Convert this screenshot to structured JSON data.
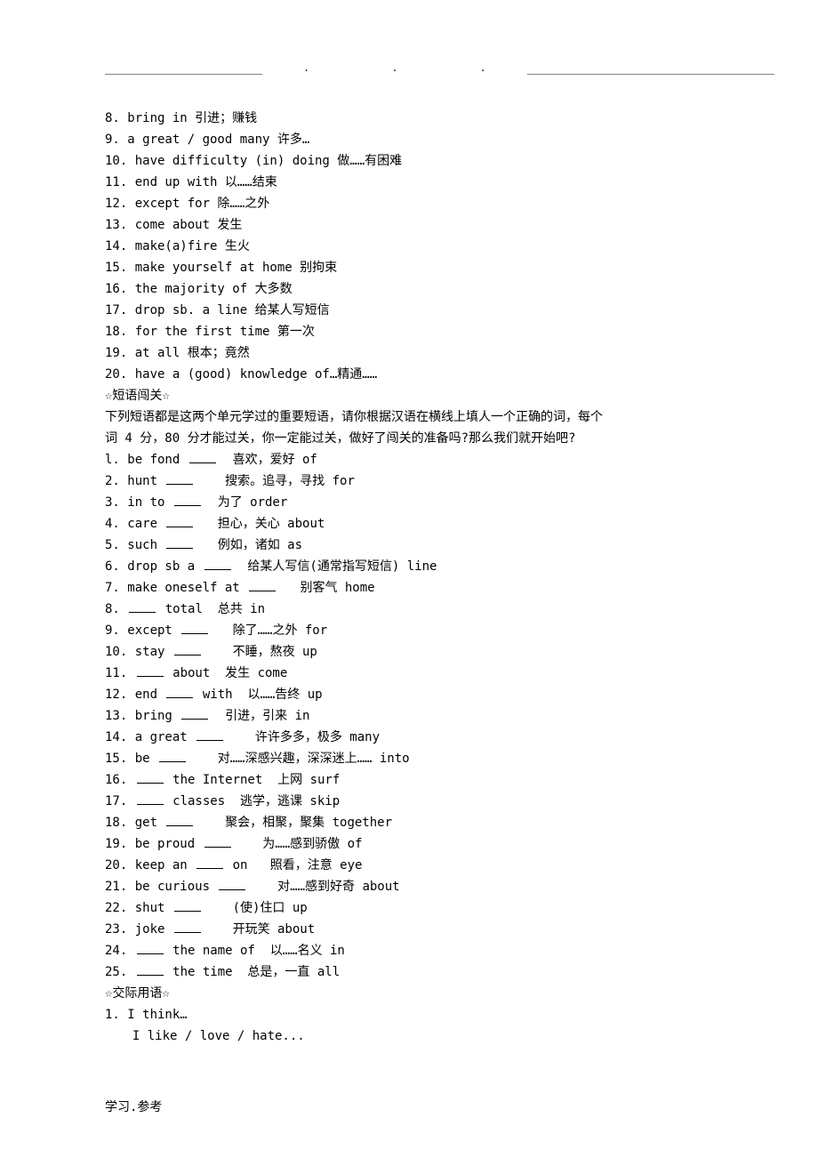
{
  "rule": {
    "u1": "_____________________",
    "dot": ".",
    "u2": "_________________________________"
  },
  "lines": [
    "8. bring in 引进；赚钱",
    "9. a great / good many 许多…",
    "10. have difficulty (in) doing 做……有困难",
    "11. end up with 以……结束",
    "12. except for 除……之外",
    "13. come about 发生",
    "14. make(a)fire 生火",
    "15. make yourself at home 别拘束",
    "16. the majority of 大多数",
    "17. drop sb. a line 给某人写短信",
    "18. for the first time 第一次",
    "19. at all 根本；竟然",
    "20. have a (good) knowledge of…精通……"
  ],
  "section1_title": "☆短语闯关☆",
  "section1_intro1": "下列短语都是这两个单元学过的重要短语，请你根据汉语在横线上填人一个正确的词，每个",
  "section1_intro2": "词 4 分，80 分才能过关，你一定能过关，做好了闯关的准备吗?那么我们就开始吧?",
  "fill_items": [
    {
      "pre": "l. be fond ",
      "post": "  喜欢，爱好 of"
    },
    {
      "pre": "2. hunt ",
      "post": "    搜索。追寻，寻找 for"
    },
    {
      "pre": "3. in to ",
      "post": "  为了 order"
    },
    {
      "pre": "4. care ",
      "post": "   担心，关心 about"
    },
    {
      "pre": "5. such ",
      "post": "   例如，诸如 as"
    },
    {
      "pre": "6. drop sb a ",
      "post": "  给某人写信(通常指写短信) line"
    },
    {
      "pre": "7. make oneself at ",
      "post": "   别客气 home"
    },
    {
      "pre": "8. ",
      "post": " total  总共 in"
    },
    {
      "pre": "9. except ",
      "post": "   除了……之外 for"
    },
    {
      "pre": "10. stay ",
      "post": "    不睡，熬夜 up"
    },
    {
      "pre": "11. ",
      "post": " about  发生 come"
    },
    {
      "pre": "12. end ",
      "post": " with  以……告终 up"
    },
    {
      "pre": "13. bring ",
      "post": "  引进，引来 in"
    },
    {
      "pre": "14. a great ",
      "post": "    许许多多，极多 many"
    },
    {
      "pre": "15. be ",
      "post": "    对……深感兴趣，深深迷上…… into"
    },
    {
      "pre": "16. ",
      "post": " the Internet  上网 surf"
    },
    {
      "pre": "17. ",
      "post": " classes  逃学，逃课 skip"
    },
    {
      "pre": "18. get ",
      "post": "    聚会，相聚，聚集 together"
    },
    {
      "pre": "19. be proud ",
      "post": "    为……感到骄傲 of"
    },
    {
      "pre": "20. keep an ",
      "post": " on   照看，注意 eye"
    },
    {
      "pre": "21. be curious ",
      "post": "    对……感到好奇 about"
    },
    {
      "pre": "22. shut ",
      "post": "    (使)住口 up"
    },
    {
      "pre": "23. joke ",
      "post": "    开玩笑 about"
    },
    {
      "pre": "24. ",
      "post": " the name of  以……名义 in"
    },
    {
      "pre": "25. ",
      "post": " the time  总是，一直 all"
    }
  ],
  "section2_title": "☆交际用语☆",
  "section2_lines": [
    "1. I think…",
    "  I like / love / hate..."
  ],
  "footer": "学习.参考"
}
